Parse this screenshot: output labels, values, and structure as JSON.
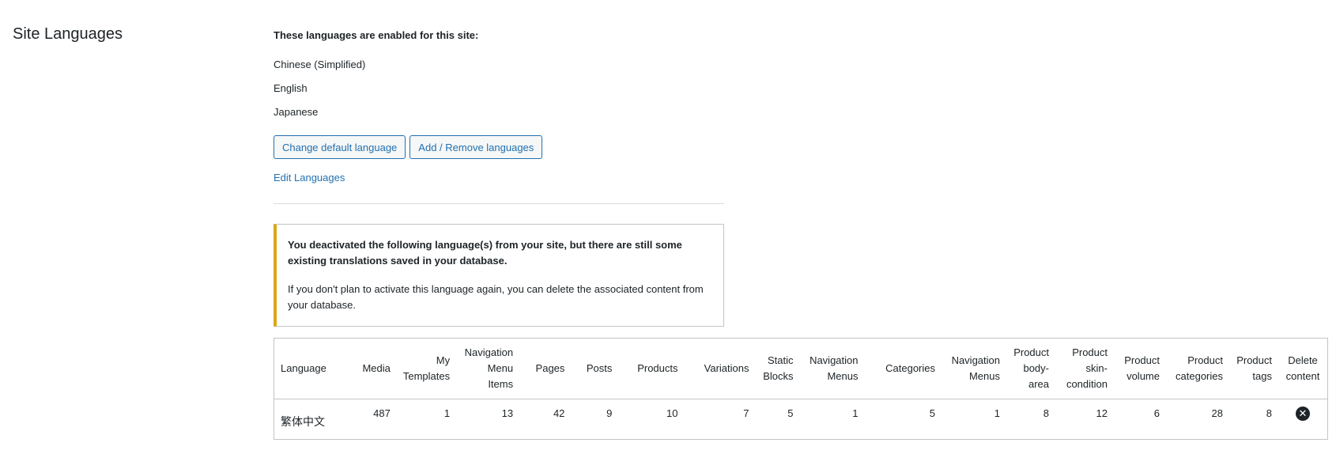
{
  "section_title": "Site Languages",
  "intro": "These languages are enabled for this site:",
  "languages": [
    "Chinese (Simplified)",
    "English",
    "Japanese"
  ],
  "buttons": {
    "change_default": "Change default language",
    "add_remove": "Add / Remove languages"
  },
  "edit_link": "Edit Languages",
  "notice": {
    "strong": "You deactivated the following language(s) from your site, but there are still some existing translations saved in your database.",
    "body": "If you don't plan to activate this language again, you can delete the associated content from your database."
  },
  "table": {
    "headers": [
      "Language",
      "Media",
      "My Templates",
      "Navigation Menu Items",
      "Pages",
      "Posts",
      "Products",
      "Variations",
      "Static Blocks",
      "Navigation Menus",
      "Categories",
      "Navigation Menus",
      "Product body-area",
      "Product skin-condition",
      "Product volume",
      "Product categories",
      "Product tags",
      "Delete content"
    ],
    "row": {
      "language": "繁体中文",
      "values": [
        "487",
        "1",
        "13",
        "42",
        "9",
        "10",
        "7",
        "5",
        "1",
        "5",
        "1",
        "8",
        "12",
        "6",
        "28",
        "8"
      ],
      "delete_icon": "close-circle-icon"
    }
  }
}
